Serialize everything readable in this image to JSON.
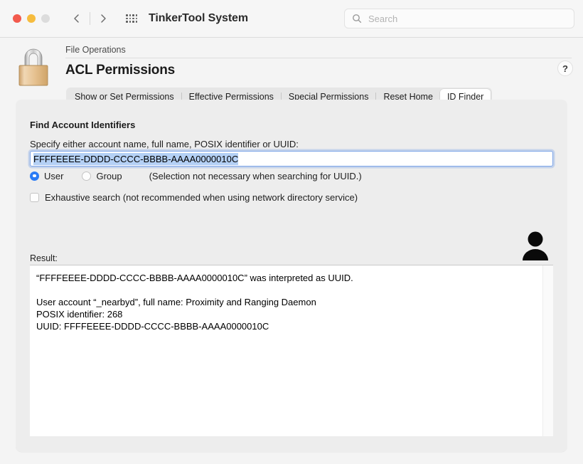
{
  "window": {
    "title": "TinkerTool System",
    "traffic_lights": [
      "close",
      "minimize",
      "zoom"
    ],
    "back_label": "Back",
    "forward_label": "Forward",
    "grid_label": "All Panes"
  },
  "search": {
    "placeholder": "Search",
    "value": "",
    "icon": "search-icon"
  },
  "header": {
    "icon": "padlock-icon",
    "breadcrumb": "File Operations",
    "title": "ACL Permissions",
    "help_label": "?"
  },
  "tabs": [
    {
      "label": "Show or Set Permissions",
      "selected": false
    },
    {
      "label": "Effective Permissions",
      "selected": false
    },
    {
      "label": "Special Permissions",
      "selected": false
    },
    {
      "label": "Reset Home",
      "selected": false
    },
    {
      "label": "ID Finder",
      "selected": true
    }
  ],
  "form": {
    "section_title": "Find Account Identifiers",
    "field_label": "Specify either account name, full name, POSIX identifier or UUID:",
    "input_value": "FFFFEEEE-DDDD-CCCC-BBBB-AAAA0000010C",
    "input_placeholder": "",
    "radio_user_label": "User",
    "radio_group_label": "Group",
    "radio_selected": "User",
    "radio_note": "(Selection not necessary when searching for UUID.)",
    "checkbox_label": "Exhaustive search (not recommended when using network directory service)",
    "checkbox_checked": false,
    "result_label": "Result:",
    "result_icon": "person-icon"
  },
  "result": {
    "lines": [
      "“FFFFEEEE-DDDD-CCCC-BBBB-AAAA0000010C” was interpreted as UUID.",
      "",
      "User account “_nearbyd”, full name: Proximity and Ranging Daemon",
      "POSIX identifier: 268",
      "UUID: FFFFEEEE-DDDD-CCCC-BBBB-AAAA0000010C"
    ],
    "text": "“FFFFEEEE-DDDD-CCCC-BBBB-AAAA0000010C” was interpreted as UUID.\n\nUser account “_nearbyd”, full name: Proximity and Ranging Daemon\nPOSIX identifier: 268\nUUID: FFFFEEEE-DDDD-CCCC-BBBB-AAAA0000010C"
  },
  "colors": {
    "accent": "#2a7bf5",
    "selection": "#b4d0f5",
    "window_bg": "#f4f4f4",
    "panel_bg": "#ededed",
    "lock_gold": "#e3bb86"
  }
}
